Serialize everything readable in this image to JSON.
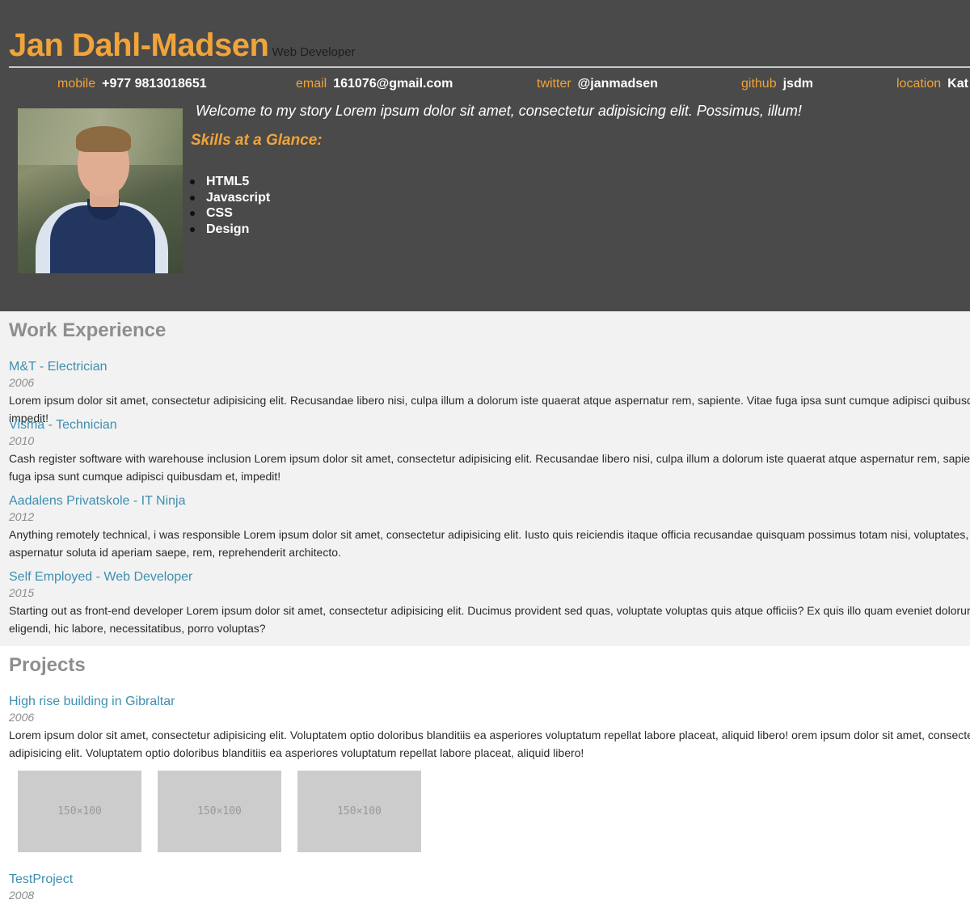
{
  "header": {
    "name": "Jan Dahl-Madsen",
    "role": "Web Developer",
    "contacts": [
      {
        "key": "mobile",
        "value": "+977 9813018651"
      },
      {
        "key": "email",
        "value": "161076@gmail.com"
      },
      {
        "key": "twitter",
        "value": "@janmadsen"
      },
      {
        "key": "github",
        "value": "jsdm"
      },
      {
        "key": "location",
        "value": "Kat"
      }
    ],
    "intro": "Welcome to my story Lorem ipsum dolor sit amet, consectetur adipisicing elit. Possimus, illum!",
    "skills_title": "Skills at a Glance:",
    "skills": [
      "HTML5",
      "Javascript",
      "CSS",
      "Design"
    ]
  },
  "work": {
    "title": "Work Experience",
    "items": [
      {
        "title": "M&T - Electrician",
        "year": "2006",
        "desc": "Lorem ipsum dolor sit amet, consectetur adipisicing elit. Recusandae libero nisi, culpa illum a dolorum iste quaerat atque aspernatur rem, sapiente. Vitae fuga ipsa sunt cumque adipisci quibusdam et, impedit!"
      },
      {
        "title": "Visma - Technician",
        "year": "2010",
        "desc": "Cash register software with warehouse inclusion Lorem ipsum dolor sit amet, consectetur adipisicing elit. Recusandae libero nisi, culpa illum a dolorum iste quaerat atque aspernatur rem, sapiente. Vitae fuga ipsa sunt cumque adipisci quibusdam et, impedit!"
      },
      {
        "title": "Aadalens Privatskole - IT Ninja",
        "year": "2012",
        "desc": "Anything remotely technical, i was responsible Lorem ipsum dolor sit amet, consectetur adipisicing elit. Iusto quis reiciendis itaque officia recusandae quisquam possimus totam nisi, voluptates, autem aspernatur soluta id aperiam saepe, rem, reprehenderit architecto."
      },
      {
        "title": "Self Employed - Web Developer",
        "year": "2015",
        "desc": "Starting out as front-end developer Lorem ipsum dolor sit amet, consectetur adipisicing elit. Ducimus provident sed quas, voluptate voluptas quis atque officiis? Ex quis illo quam eveniet dolorum eligendi, hic labore, necessitatibus, porro voluptas?"
      }
    ]
  },
  "projects": {
    "title": "Projects",
    "items": [
      {
        "title": "High rise building in Gibraltar",
        "year": "2006",
        "desc": "Lorem ipsum dolor sit amet, consectetur adipisicing elit. Voluptatem optio doloribus blanditiis ea asperiores voluptatum repellat labore placeat, aliquid libero! orem ipsum dolor sit amet, consectetur adipisicing elit. Voluptatem optio doloribus blanditiis ea asperiores voluptatum repellat labore placeat, aliquid libero!"
      },
      {
        "title": "TestProject",
        "year": "2008"
      }
    ],
    "thumb_label": "150×100"
  }
}
